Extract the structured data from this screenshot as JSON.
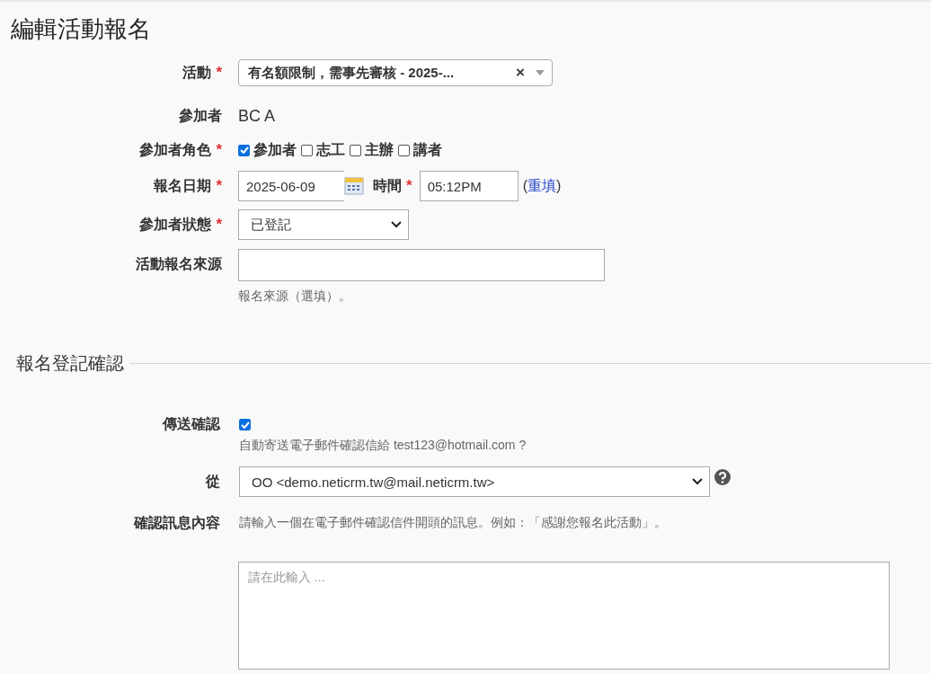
{
  "page_title": "編輯活動報名",
  "fields": [
    {
      "kind": "combo",
      "label": "活動",
      "required_mark": "*",
      "value": "有名額限制，需事先審核 - 2025-...",
      "clear": "×"
    },
    {
      "kind": "static",
      "label": "參加者",
      "value": "BC A"
    },
    {
      "kind": "checkboxes",
      "label": "參加者角色",
      "required_mark": "*",
      "options": [
        {
          "label": "參加者",
          "checked": true
        },
        {
          "label": "志工",
          "checked": false
        },
        {
          "label": "主辦",
          "checked": false
        },
        {
          "label": "講者",
          "checked": false
        }
      ]
    },
    {
      "kind": "datetime",
      "label": "報名日期",
      "required_mark": "*",
      "date": "2025-06-09",
      "time_label": "時間",
      "time_required_mark": "*",
      "time": "05:12PM",
      "reset_open": "(",
      "reset_link": "重填",
      "reset_close": ")"
    },
    {
      "kind": "select",
      "label": "參加者狀態",
      "required_mark": "*",
      "value": "已登記"
    },
    {
      "kind": "text",
      "label": "活動報名來源",
      "help": "報名來源（選填）。"
    }
  ],
  "section": {
    "title": "報名登記確認",
    "fields": [
      {
        "kind": "checkbox",
        "label": "傳送確認",
        "checked": true,
        "help": "自動寄送電子郵件確認信給 test123@hotmail.com ?"
      },
      {
        "kind": "select",
        "label": "從",
        "value": "OO <demo.neticrm.tw@mail.neticrm.tw>",
        "help_icon": true
      },
      {
        "kind": "textarea",
        "label": "確認訊息內容",
        "description": "請輸入一個在電子郵件確認信件開頭的訊息。例如：「感謝您報名此活動」。",
        "placeholder": "請在此輸入 ..."
      }
    ]
  }
}
